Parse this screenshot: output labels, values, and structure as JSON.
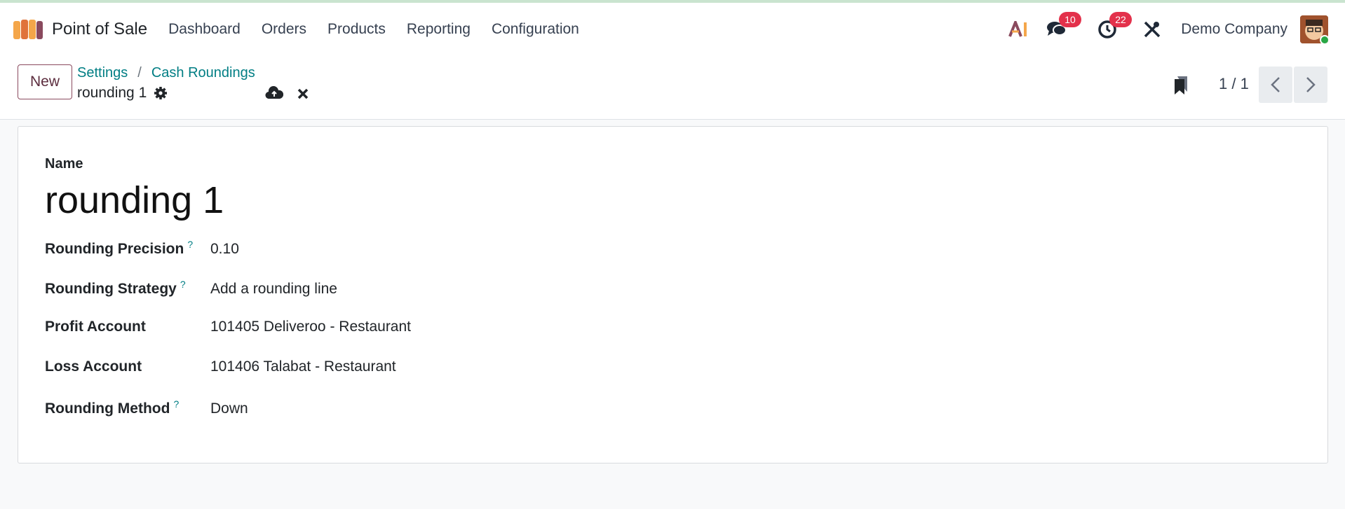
{
  "app": {
    "name": "Point of Sale"
  },
  "menu": [
    "Dashboard",
    "Orders",
    "Products",
    "Reporting",
    "Configuration"
  ],
  "navbar": {
    "messages_badge": "10",
    "activities_badge": "22",
    "company": "Demo Company"
  },
  "control": {
    "new_label": "New",
    "breadcrumb": [
      "Settings",
      "Cash Roundings"
    ],
    "breadcrumb_sep": "/",
    "record_title": "rounding 1",
    "pager": "1 / 1"
  },
  "form": {
    "name_label": "Name",
    "name_value": "rounding 1",
    "fields": [
      {
        "label": "Rounding Precision",
        "help": "?",
        "value": "0.10"
      },
      {
        "label": "Rounding Strategy",
        "help": "?",
        "value": "Add a rounding line"
      },
      {
        "label": "Profit Account",
        "help": "",
        "value": "101405 Deliveroo - Restaurant"
      },
      {
        "label": "Loss Account",
        "help": "",
        "value": "101406 Talabat - Restaurant"
      },
      {
        "label": "Rounding Method",
        "help": "?",
        "value": "Down"
      }
    ]
  },
  "icons": [
    "app-logo-icon",
    "ai-icon",
    "chat-icon",
    "clock-icon",
    "tools-icon",
    "gear-icon",
    "cloud-upload-icon",
    "close-icon",
    "bookmark-icon",
    "chevron-left-icon",
    "chevron-right-icon"
  ],
  "colors": {
    "accent": "#017e84",
    "badge": "#e3314b",
    "primary_border": "#8a4a5e"
  }
}
